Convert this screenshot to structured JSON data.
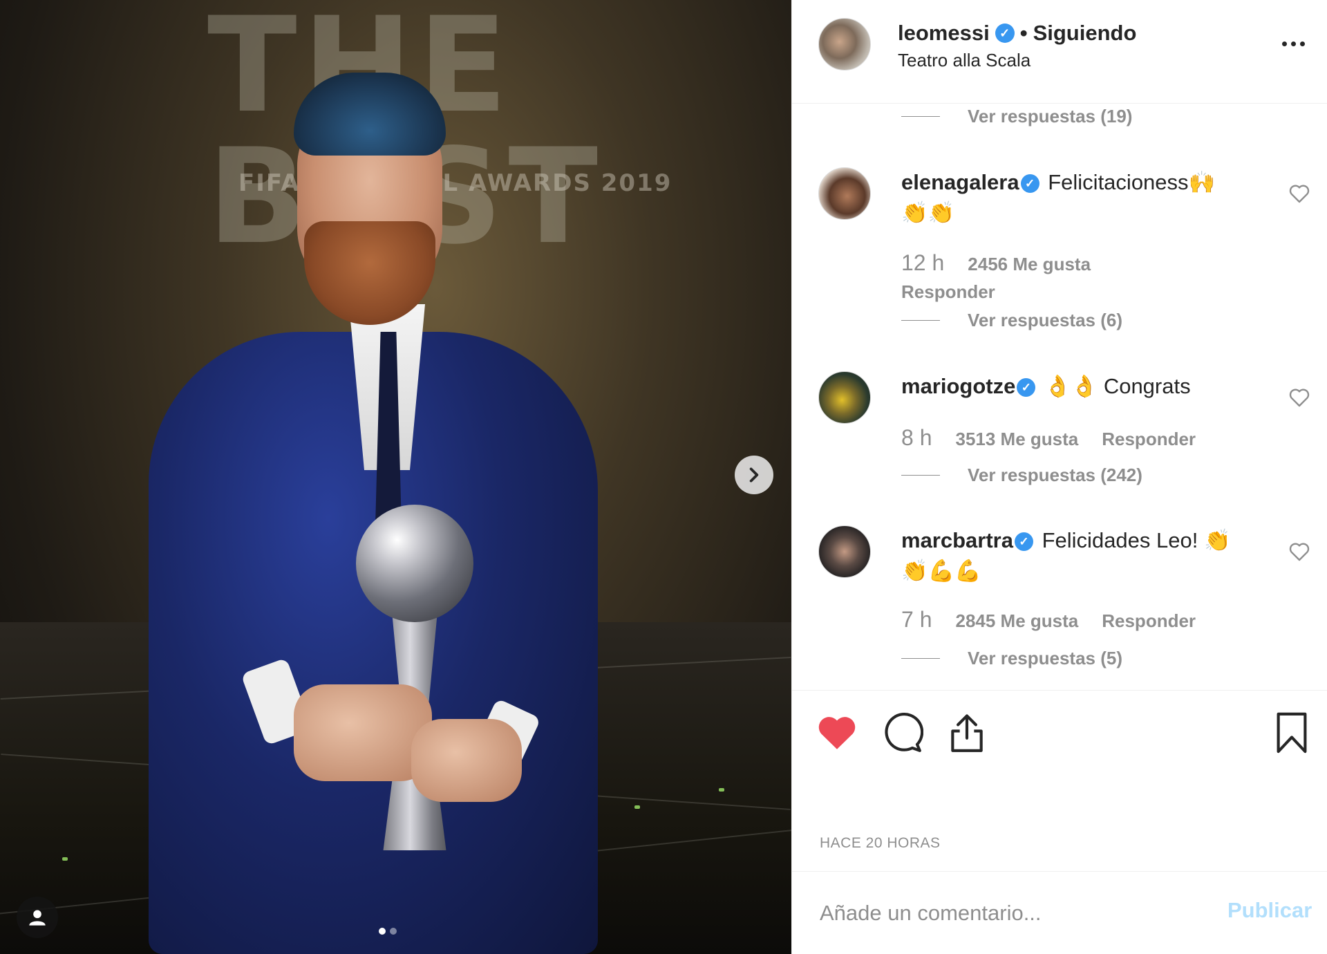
{
  "post": {
    "owner": {
      "username": "leomessi",
      "verified_icon": "verified-badge-icon",
      "separator": "•",
      "follow_status": "Siguiendo",
      "location": "Teatro alla Scala"
    },
    "photo": {
      "backdrop_text": "THE BEST",
      "backdrop_subtext": "FIFA FOOTBALL AWARDS 2019",
      "carousel_count": 2,
      "carousel_active": 0
    },
    "timestamp": "HACE 20 HORAS",
    "liked": true
  },
  "comments": {
    "top_replies_label": "Ver respuestas (19)",
    "items": [
      {
        "username": "elenagalera",
        "text": "Felicitacioness",
        "emoji_inline": "🙌",
        "emoji_line2": "👏👏",
        "time": "12 h",
        "likes": "2456 Me gusta",
        "reply": "Responder",
        "replies": "Ver respuestas (6)"
      },
      {
        "username": "mariogotze",
        "emoji_inline": "👌👌",
        "text": "Congrats",
        "time": "8 h",
        "likes": "3513 Me gusta",
        "reply": "Responder",
        "replies": "Ver respuestas (242)"
      },
      {
        "username": "marcbartra",
        "text": "Felicidades Leo!",
        "emoji_inline": "👏",
        "emoji_line2": "👏💪💪",
        "time": "7 h",
        "likes": "2845 Me gusta",
        "reply": "Responder",
        "replies": "Ver respuestas (5)"
      }
    ]
  },
  "composer": {
    "placeholder": "Añade un comentario...",
    "publish_label": "Publicar"
  },
  "colors": {
    "like_red": "#ed4956",
    "verified_blue": "#3897f0",
    "publish_disabled": "#b2dffc",
    "muted_text": "#8e8e8e"
  },
  "icons": [
    "chevron-right-icon",
    "user-tag-icon",
    "more-options-icon",
    "heart-outline-icon",
    "heart-filled-icon",
    "comment-icon",
    "share-icon",
    "bookmark-icon"
  ]
}
